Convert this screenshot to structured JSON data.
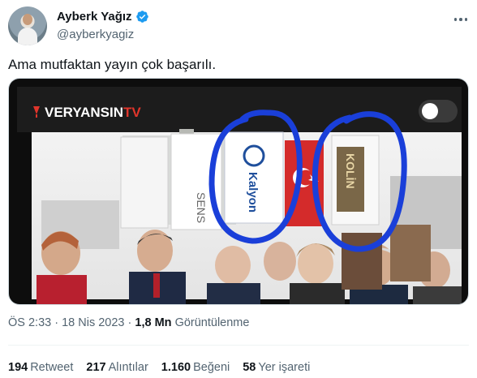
{
  "author": {
    "display_name": "Ayberk Yağız",
    "handle": "@ayberkyagiz",
    "verified": true,
    "verified_color": "#1d9bf0"
  },
  "tweet": {
    "text": "Ama mutfaktan yayın çok başarılı."
  },
  "media": {
    "channel_logo": "VERYANSINTV",
    "channel_logo_part1": "VERYANSIN",
    "channel_logo_part2": "TV",
    "banner_text_1": "Kalyon",
    "banner_text_2": "KOLİN",
    "banner_text_3": "SENS"
  },
  "meta": {
    "time": "ÖS 2:33",
    "separator": "·",
    "date": "18 Nis 2023",
    "views_count": "1,8 Mn",
    "views_label": "Görüntülenme"
  },
  "stats": {
    "retweets_count": "194",
    "retweets_label": "Retweet",
    "quotes_count": "217",
    "quotes_label": "Alıntılar",
    "likes_count": "1.160",
    "likes_label": "Beğeni",
    "bookmarks_count": "58",
    "bookmarks_label": "Yer işareti"
  },
  "icons": {
    "more": "more-dots-icon",
    "verified": "verified-badge-icon"
  }
}
